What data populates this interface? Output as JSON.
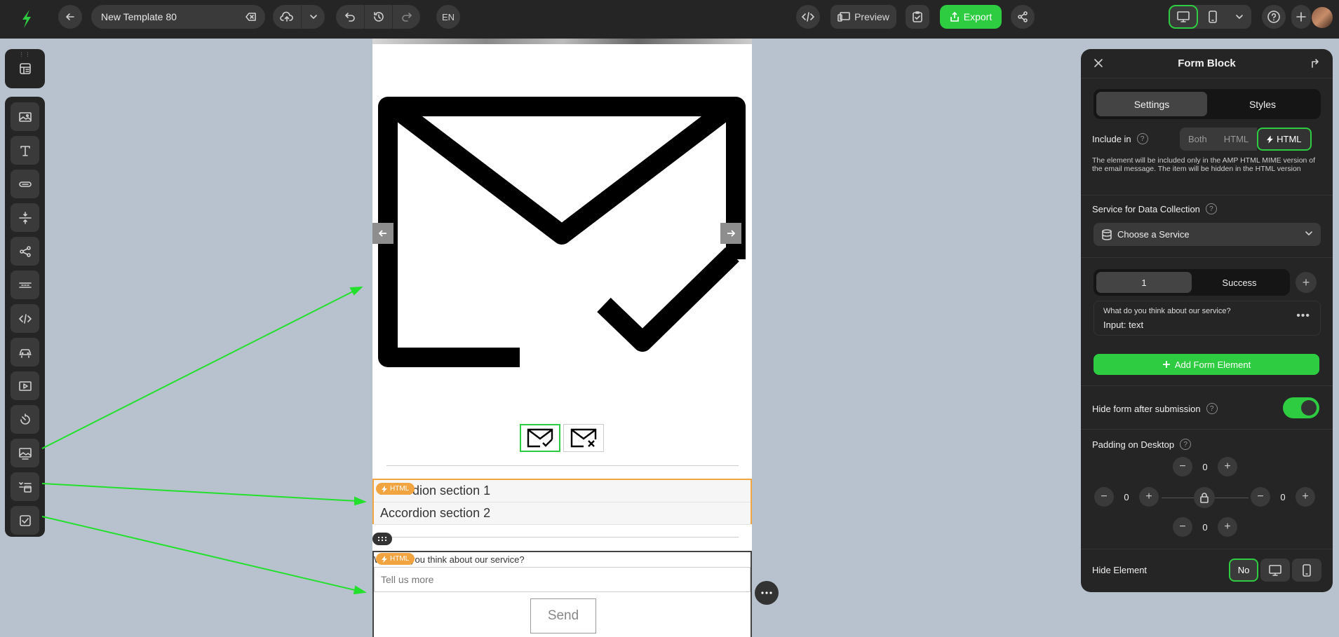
{
  "topbar": {
    "template_name": "New Template 80",
    "language": "EN",
    "preview_label": "Preview",
    "export_label": "Export"
  },
  "canvas": {
    "accordion": {
      "badge": "HTML",
      "sections": [
        "Accordion section 1",
        "Accordion section 2"
      ]
    },
    "form": {
      "badge": "HTML",
      "question": "What do you think about our service?",
      "input_placeholder": "Tell us more",
      "send_label": "Send"
    }
  },
  "panel": {
    "title": "Form Block",
    "tabs": [
      "Settings",
      "Styles"
    ],
    "include_in": {
      "label": "Include in",
      "options": [
        "Both",
        "HTML",
        "HTML"
      ],
      "selected": 2,
      "note": "The element will be included only in the AMP HTML MIME version of the email message. The item will be hidden in the HTML version"
    },
    "service": {
      "label": "Service for Data Collection",
      "placeholder": "Choose a Service"
    },
    "steps": [
      "1",
      "Success"
    ],
    "form_element": {
      "question": "What do you think about our service?",
      "type": "Input: text"
    },
    "add_form_element_label": "Add Form Element",
    "hide_after_submission": {
      "label": "Hide form after submission",
      "enabled": true
    },
    "padding": {
      "label": "Padding on Desktop",
      "top": "0",
      "left": "0",
      "right": "0",
      "bottom": "0"
    },
    "hide_element": {
      "label": "Hide Element",
      "no_label": "No"
    }
  },
  "colors": {
    "accent": "#2ecc40",
    "highlight": "#f2a440",
    "panel_bg": "#252525"
  }
}
